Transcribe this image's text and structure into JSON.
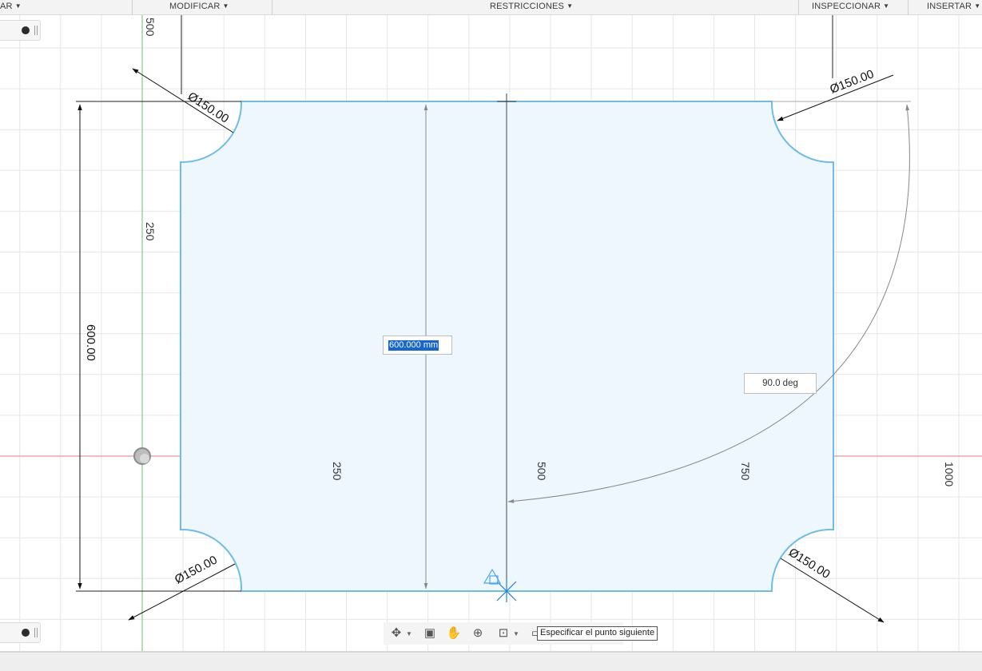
{
  "toolbar": {
    "crear_label": "AR",
    "modificar_label": "MODIFICAR",
    "restricciones_label": "RESTRICCIONES",
    "inspeccionar_label": "INSPECCIONAR",
    "insertar_label": "INSERTAR"
  },
  "sketch": {
    "diameter_label": "Ø150.00",
    "height_dimension_label": "600.00",
    "active_input_value": "600.000 mm",
    "angle_value": "90.0 deg",
    "ruler_x_labels": [
      "250",
      "500",
      "750",
      "1000"
    ],
    "ruler_y_labels": [
      "500",
      "250"
    ]
  },
  "navigation": {
    "icons": [
      "orbit-icon",
      "look-at-icon",
      "pan-icon",
      "zoom-icon",
      "fit-icon",
      "display-settings-icon",
      "grid-icon"
    ]
  },
  "tooltip": {
    "text": "Especificar el punto siguiente"
  },
  "colors": {
    "profile_stroke": "#6dbde6",
    "profile_fill": "#eef7fd",
    "x_axis": "#e89898",
    "y_axis": "#7ecf7e",
    "grid": "#e4e4e4",
    "selection": "#1565d8"
  }
}
